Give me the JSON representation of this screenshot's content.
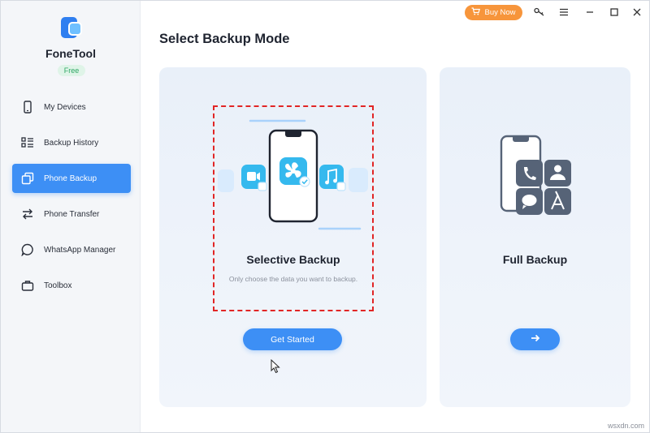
{
  "app": {
    "name": "FoneTool",
    "badge": "Free"
  },
  "sidebar": {
    "items": [
      {
        "label": "My Devices",
        "icon": "phone-icon",
        "active": false
      },
      {
        "label": "Backup History",
        "icon": "list-icon",
        "active": false
      },
      {
        "label": "Phone Backup",
        "icon": "copy-icon",
        "active": true
      },
      {
        "label": "Phone Transfer",
        "icon": "transfer-arrows-icon",
        "active": false
      },
      {
        "label": "WhatsApp Manager",
        "icon": "chat-bubble-icon",
        "active": false
      },
      {
        "label": "Toolbox",
        "icon": "toolbox-icon",
        "active": false
      }
    ]
  },
  "titlebar": {
    "buy_now": "Buy Now",
    "icons": [
      "cart-icon",
      "key-icon",
      "menu-icon",
      "minimize-icon",
      "maximize-icon",
      "close-icon"
    ]
  },
  "main": {
    "title": "Select Backup Mode",
    "cards": [
      {
        "title": "Selective Backup",
        "description": "Only choose the data you want to backup.",
        "button_label": "Get Started"
      },
      {
        "title": "Full Backup",
        "button_icon": "arrow-right-icon"
      }
    ]
  },
  "watermark": "wsxdn.com",
  "colors": {
    "accent": "#3d8ff5",
    "buy": "#f7953b",
    "selection": "#e12525",
    "dark_tile": "#566377"
  }
}
